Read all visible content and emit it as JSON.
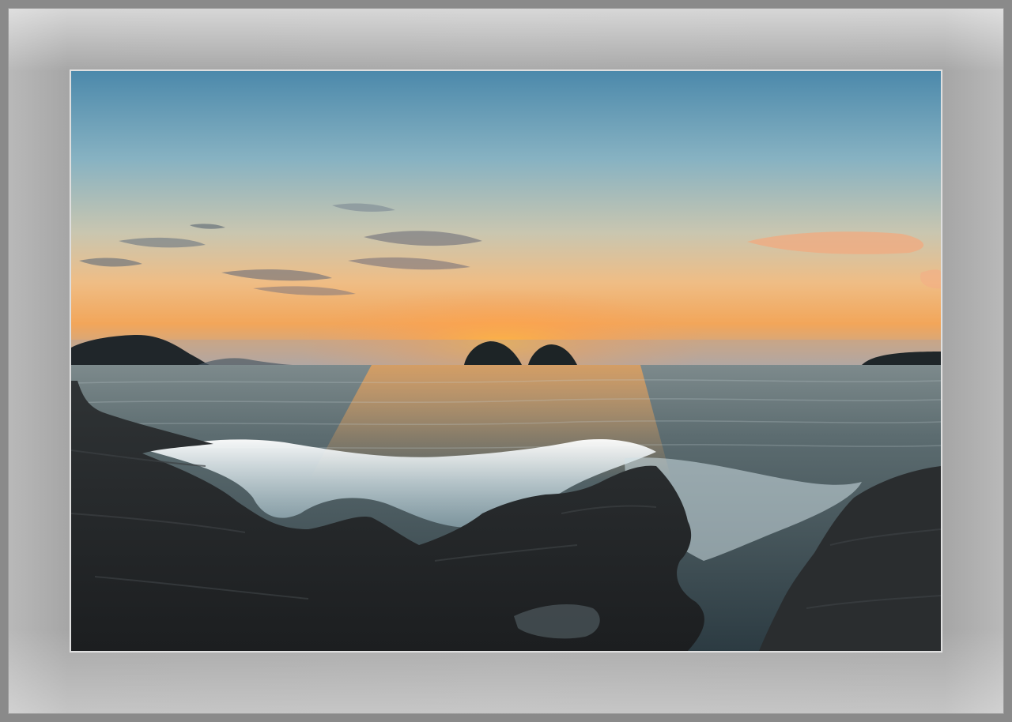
{
  "scene": {
    "subject": "sunset-seascape",
    "colors": {
      "sky_top": "#4f8fb0",
      "sky_mid": "#9cc0c9",
      "sky_glow": "#f0b86a",
      "sun_core": "#ffb24a",
      "sea_far": "#6b7f86",
      "sea_near": "#2a3940",
      "rock": "#26292b",
      "foam": "#e9f3f6",
      "mat": "#a9a9a9"
    }
  }
}
